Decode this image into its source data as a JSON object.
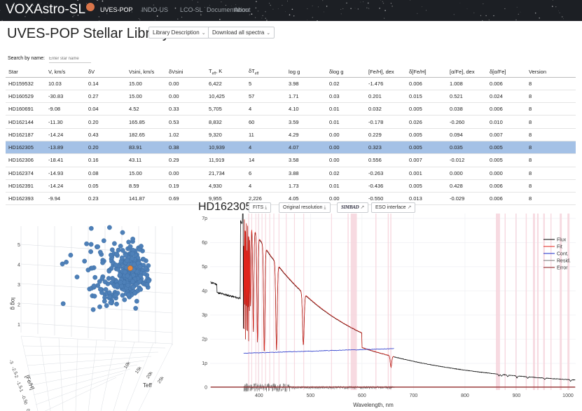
{
  "navbar": {
    "brand": "VOXAstro-SL",
    "links": [
      "UVES-POP",
      "INDO-US",
      "LCO-SL",
      "Documentation",
      "About"
    ]
  },
  "title": "UVES-POP Stellar Library",
  "buttons": {
    "library_description": "Library Description",
    "download_all": "Download all spectra"
  },
  "search": {
    "label": "Search by name:",
    "placeholder": "Enter star name"
  },
  "table": {
    "headers": [
      "Star",
      "V, km/s",
      "δV",
      "Vsini, km/s",
      "δVsini",
      "T",
      "δT",
      "log g",
      "δlog g",
      "[Fe/H], dex",
      "δ[Fe/H]",
      "[α/Fe], dex",
      "δ[α/Fe]",
      "Version"
    ],
    "teff_header": {
      "main": "T",
      "sub": "eff",
      "suffix": ", K"
    },
    "dteff_header": {
      "main": "δT",
      "sub": "eff"
    },
    "rows": [
      [
        "HD159532",
        "10.03",
        "0.14",
        "15.00",
        "0.00",
        "6,422",
        "5",
        "3.98",
        "0.02",
        "-1.476",
        "0.006",
        "1.008",
        "0.006",
        "8"
      ],
      [
        "HD160529",
        "-30.83",
        "0.27",
        "15.00",
        "0.00",
        "10,425",
        "57",
        "1.71",
        "0.03",
        "0.201",
        "0.015",
        "0.521",
        "0.024",
        "8"
      ],
      [
        "HD160691",
        "-9.08",
        "0.04",
        "4.52",
        "0.33",
        "5,705",
        "4",
        "4.10",
        "0.01",
        "0.032",
        "0.005",
        "0.038",
        "0.006",
        "8"
      ],
      [
        "HD162144",
        "-11.30",
        "0.20",
        "165.85",
        "0.53",
        "8,832",
        "60",
        "3.59",
        "0.01",
        "-0.178",
        "0.026",
        "-0.260",
        "0.010",
        "8"
      ],
      [
        "HD162187",
        "-14.24",
        "0.43",
        "182.65",
        "1.02",
        "9,320",
        "11",
        "4.29",
        "0.00",
        "0.229",
        "0.005",
        "0.094",
        "0.007",
        "8"
      ],
      [
        "HD162305",
        "-13.89",
        "0.20",
        "83.91",
        "0.38",
        "10,939",
        "4",
        "4.07",
        "0.00",
        "0.323",
        "0.005",
        "0.035",
        "0.005",
        "8"
      ],
      [
        "HD162306",
        "-18.41",
        "0.16",
        "43.11",
        "0.29",
        "11,919",
        "14",
        "3.58",
        "0.00",
        "0.556",
        "0.007",
        "-0.012",
        "0.005",
        "8"
      ],
      [
        "HD162374",
        "-14.93",
        "0.08",
        "15.00",
        "0.00",
        "21,734",
        "6",
        "3.88",
        "0.02",
        "-0.263",
        "0.001",
        "0.000",
        "0.000",
        "8"
      ],
      [
        "HD162391",
        "-14.24",
        "0.05",
        "8.59",
        "0.19",
        "4,930",
        "4",
        "1.73",
        "0.01",
        "-0.436",
        "0.005",
        "0.428",
        "0.006",
        "8"
      ],
      [
        "HD162393",
        "-9.94",
        "0.23",
        "141.87",
        "0.69",
        "9,955",
        "2,226",
        "4.05",
        "0.00",
        "-0.550",
        "0.013",
        "-0.029",
        "0.006",
        "8"
      ]
    ],
    "selected_row": 5
  },
  "star_panel": {
    "name": "HD162305",
    "buttons": {
      "fits": "FITS",
      "original_resolution": "Original resolution",
      "simbad": "SIMBAD",
      "eso": "ESO interface"
    }
  },
  "chart_data": [
    {
      "type": "scatter3d",
      "axes": {
        "x": "Teff",
        "y": "[Fe/H]",
        "z": "log g"
      },
      "z_ticks": [
        "1",
        "2",
        "3",
        "4",
        "5"
      ],
      "y_ticks": [
        "-3",
        "-2.5",
        "-2",
        "-1.5",
        "-1",
        "-0.5",
        "0",
        "0.5"
      ],
      "x_ticks": [
        "10k",
        "15k",
        "20k",
        "25k"
      ],
      "highlight": "HD162305",
      "colors": {
        "points": "#4e80b8",
        "highlight": "#e8883b"
      }
    },
    {
      "type": "line",
      "xlabel": "Wavelength, nm",
      "x_ticks": [
        400,
        500,
        600,
        700,
        800,
        900,
        1000
      ],
      "y_ticks": [
        "0",
        "1p",
        "2p",
        "3p",
        "4p",
        "5p",
        "6p",
        "7p"
      ],
      "xlim": [
        305,
        1015
      ],
      "ylim": [
        -0.1,
        7.2
      ],
      "legend_position": "right",
      "series": [
        {
          "name": "Flux",
          "color": "#000000"
        },
        {
          "name": "Fit",
          "color": "#e0251c"
        },
        {
          "name": "Cont.",
          "color": "#1a2cc8"
        },
        {
          "name": "Resid.",
          "color": "#777777"
        },
        {
          "name": "Error",
          "color": "#8b1a1a"
        }
      ],
      "masked_regions": [
        [
          379,
          381
        ],
        [
          385,
          386
        ],
        [
          393,
          394
        ],
        [
          398,
          399
        ],
        [
          405,
          406
        ],
        [
          412,
          413
        ],
        [
          420,
          421
        ],
        [
          428,
          429
        ],
        [
          438,
          439
        ],
        [
          452,
          453
        ],
        [
          468,
          469
        ],
        [
          486,
          487
        ],
        [
          540,
          541
        ],
        [
          572,
          574
        ],
        [
          578,
          590
        ],
        [
          626,
          628
        ],
        [
          650,
          652
        ],
        [
          655,
          657
        ],
        [
          860,
          868
        ],
        [
          877,
          879
        ],
        [
          898,
          900
        ],
        [
          918,
          920
        ],
        [
          932,
          936
        ],
        [
          940,
          943
        ],
        [
          952,
          955
        ],
        [
          966,
          968
        ],
        [
          984,
          988
        ],
        [
          999,
          1003
        ]
      ]
    }
  ]
}
